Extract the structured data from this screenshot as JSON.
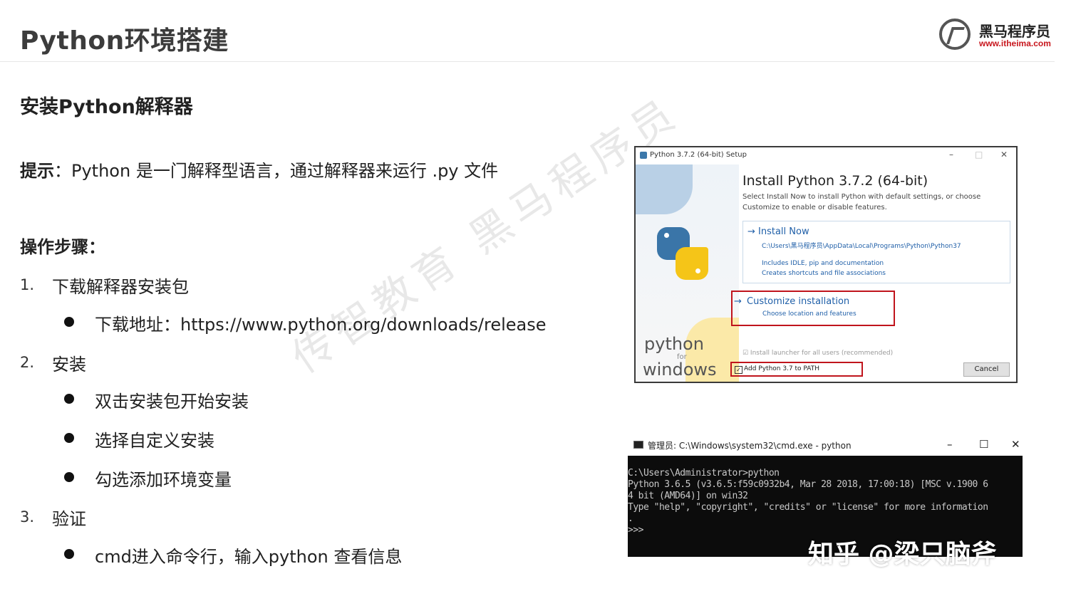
{
  "header": {
    "title": "Python环境搭建",
    "logo_name": "黑马程序员",
    "logo_url": "www.itheima.com"
  },
  "subtitle": "安装Python解释器",
  "tip": {
    "label": "提示",
    "text": "：Python 是一门解释型语言，通过解释器来运行 .py 文件"
  },
  "steps_heading": "操作步骤：",
  "steps": [
    {
      "num": "1.",
      "text": "下载解释器安装包",
      "subs": [
        "下载地址：https://www.python.org/downloads/release"
      ]
    },
    {
      "num": "2.",
      "text": "安装",
      "subs": [
        "双击安装包开始安装",
        "选择自定义安装",
        "勾选添加环境变量"
      ]
    },
    {
      "num": "3.",
      "text": "验证",
      "subs": [
        "cmd进入命令行，输入python 查看信息"
      ]
    }
  ],
  "watermark": "传智教育 黑马程序员",
  "installer": {
    "window_title": "Python 3.7.2 (64-bit) Setup",
    "minimize": "–",
    "maximize": "□",
    "close": "✕",
    "heading": "Install Python 3.7.2 (64-bit)",
    "desc_line1": "Select Install Now to install Python with default settings, or choose",
    "desc_line2": "Customize to enable or disable features.",
    "install_now": "→ Install Now",
    "install_path": "C:\\Users\\黑马程序员\\AppData\\Local\\Programs\\Python\\Python37",
    "includes_line1": "Includes IDLE, pip and documentation",
    "includes_line2": "Creates shortcuts and file associations",
    "customize_arrow": "→",
    "customize_title": "Customize installation",
    "customize_sub": "Choose location and features",
    "launcher": "☑ Install launcher for all users (recommended)",
    "path_check_mark": "✓",
    "add_path": "Add Python 3.7 to PATH",
    "cancel": "Cancel",
    "side_python": "python",
    "side_for": "for",
    "side_windows": "windows"
  },
  "console": {
    "window_title": "管理员: C:\\Windows\\system32\\cmd.exe - python",
    "minimize": "–",
    "maximize": "☐",
    "close": "✕",
    "lines": [
      "C:\\Users\\Administrator>python",
      "Python 3.6.5 (v3.6.5:f59c0932b4, Mar 28 2018, 17:00:18) [MSC v.1900 6",
      "4 bit (AMD64)] on win32",
      "Type \"help\", \"copyright\", \"credits\" or \"license\" for more information",
      ".",
      ">>>"
    ]
  },
  "zhihu_watermark": "知乎 @梁只脑斧",
  "colors": {
    "accent_red": "#c0141c",
    "link_blue": "#1f5fa8",
    "console_bg": "#0c0c0c"
  }
}
